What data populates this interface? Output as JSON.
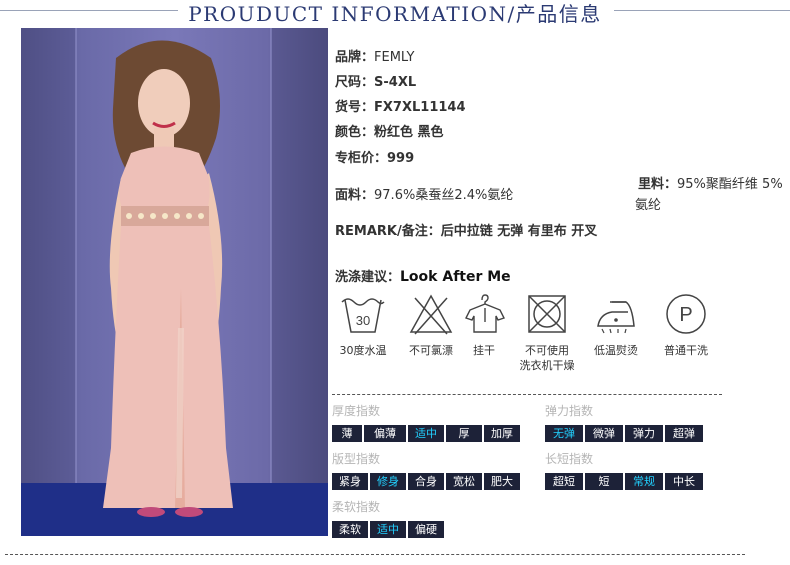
{
  "header": {
    "title": "PROUDUCT INFORMATION/产品信息"
  },
  "specs": {
    "brand_label": "品牌：",
    "brand_value": "FEMLY",
    "size_label": "尺码：",
    "size_value": "S-4XL",
    "sku_label": "货号：",
    "sku_value": "FX7XL11144",
    "color_label": "颜色：",
    "color_value": "粉红色 黑色",
    "price_label": "专柜价：",
    "price_value": "999",
    "fabric_label": "面料：",
    "fabric_value": "97.6%桑蚕丝2.4%氨纶",
    "lining_label": "里料：",
    "lining_value": "95%聚酯纤维 5%",
    "lining_value_cont": "氨纶",
    "remark_label": "REMARK/备注：",
    "remark_value": "后中拉链 无弹 有里布 开叉"
  },
  "care": {
    "title_label": "洗涤建议：",
    "title_en": "Look After Me",
    "items": [
      {
        "icon": "wash-30-icon",
        "number": "30",
        "label": "30度水温"
      },
      {
        "icon": "no-bleach-icon",
        "label": "不可氯漂"
      },
      {
        "icon": "hang-dry-icon",
        "label": "挂干"
      },
      {
        "icon": "no-tumble-dry-icon",
        "label": "不可使用",
        "label2": "洗衣机干燥"
      },
      {
        "icon": "low-iron-icon",
        "label": "低温熨烫"
      },
      {
        "icon": "dry-clean-icon",
        "letter": "P",
        "label": "普通干洗"
      }
    ]
  },
  "indices": {
    "thickness": {
      "label": "厚度指数",
      "options": [
        "薄",
        "偏薄",
        "适中",
        "厚",
        "加厚"
      ],
      "selected": "适中"
    },
    "elasticity": {
      "label": "弹力指数",
      "options": [
        "无弹",
        "微弹",
        "弹力",
        "超弹"
      ],
      "selected": "无弹"
    },
    "fit": {
      "label": "版型指数",
      "options": [
        "紧身",
        "修身",
        "合身",
        "宽松",
        "肥大"
      ],
      "selected": "修身"
    },
    "length": {
      "label": "长短指数",
      "options": [
        "超短",
        "短",
        "常规",
        "中长"
      ],
      "selected": "常规"
    },
    "softness": {
      "label": "柔软指数",
      "options": [
        "柔软",
        "适中",
        "偏硬"
      ],
      "selected": "适中"
    }
  },
  "colors": {
    "accent": "#22d1ff",
    "chip_bg": "#1d2238",
    "header": "#2b3a73",
    "dress": "#eec0b8"
  }
}
